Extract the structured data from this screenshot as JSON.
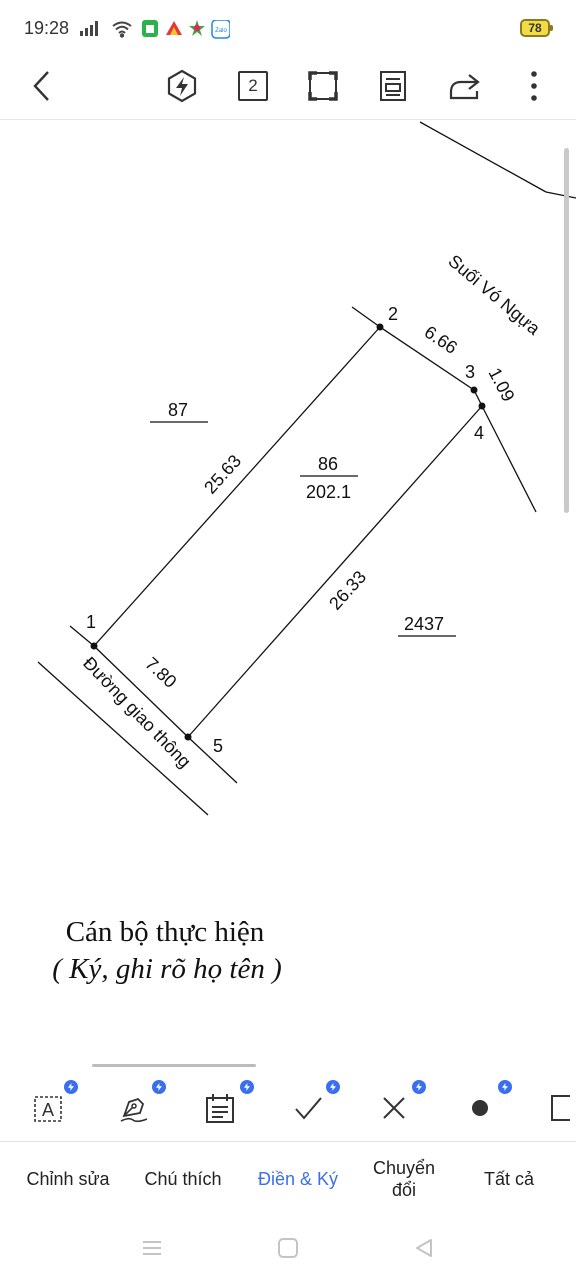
{
  "status_bar": {
    "time": "19:28",
    "battery": "78",
    "icons": [
      "signal-icon",
      "wifi-icon",
      "notification-app-icon",
      "notification-app-icon",
      "notification-app-icon",
      "zalo-icon"
    ]
  },
  "toolbar": {
    "page_count": "2",
    "icons": [
      "back-arrow-icon",
      "pro-features-icon",
      "page-count-icon",
      "fit-screen-icon",
      "reading-mode-icon",
      "share-icon",
      "more-icon"
    ]
  },
  "drawing": {
    "road_label": "Đường giao thông",
    "stream_label": "Suối Vó Ngựa",
    "parcels": {
      "north": "87",
      "main_number": "86",
      "main_area": "202.1",
      "east": "2437"
    },
    "edge_lengths": {
      "e_1_2": "25.63",
      "e_2_3": "6.66",
      "e_3_4": "1.09",
      "e_4_5": "26.33",
      "e_5_1": "7.80"
    },
    "points": [
      "1",
      "2",
      "3",
      "4",
      "5"
    ]
  },
  "signature": {
    "title": "Cán bộ thực hiện",
    "subtitle": "( Ký, ghi rõ họ tên )"
  },
  "tools": [
    "text-box-icon",
    "pen-sign-icon",
    "date-icon",
    "checkmark-icon",
    "cross-icon",
    "dot-icon",
    "rectangle-icon"
  ],
  "tabs": [
    {
      "label": "Chỉnh sửa",
      "active": false
    },
    {
      "label": "Chú thích",
      "active": false
    },
    {
      "label": "Điền & Ký",
      "active": true
    },
    {
      "label_line1": "Chuyển",
      "label_line2": "đổi",
      "active": false
    },
    {
      "label": "Tất cả",
      "active": false
    }
  ],
  "colors": {
    "accent": "#3d6fe8",
    "badge": "#3a6ff0",
    "battery": "#f2dc45"
  }
}
